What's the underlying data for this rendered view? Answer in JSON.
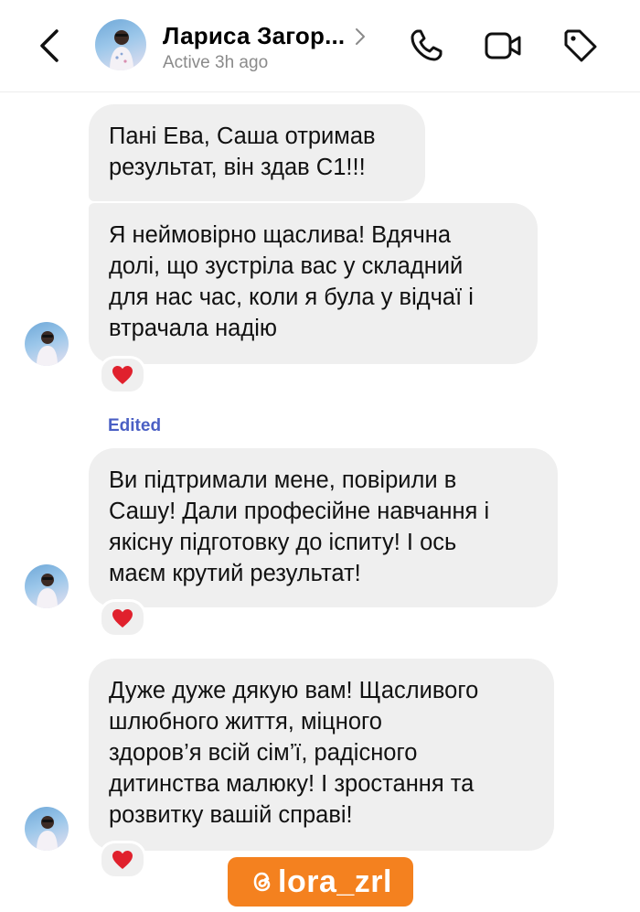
{
  "header": {
    "contact_name": "Лариса Загор...",
    "status": "Active 3h ago",
    "icons": [
      "back-arrow-icon",
      "chevron-right-icon",
      "phone-icon",
      "video-camera-icon",
      "tag-icon"
    ]
  },
  "messages": [
    {
      "text": "Пані Ева, Саша отримав\nрезультат, він здав С1!!!",
      "reaction": null
    },
    {
      "text": "Я неймовірно щаслива! Вдячна\nдолі, що зустріла вас у складний\nдля нас час, коли я була у відчаї і\nвтрачала надію",
      "reaction": "heart"
    },
    {
      "label": "Edited",
      "text": "Ви підтримали мене, повірили в\nСашу! Дали професійне навчання і\nякісну підготовку до іспиту! І ось\nмаєм крутий результат!",
      "reaction": "heart"
    },
    {
      "text": "Дуже дуже дякую вам! Щасливого\nшлюбного життя, міцного\nздоров’я всій сім’ї, радісного\nдитинства малюку! І зростання та\nрозвитку вашій справі!",
      "reaction": "heart"
    }
  ],
  "watermark": {
    "handle": "lora_zrl",
    "icon": "threads-icon"
  },
  "colors": {
    "bubble": "#efefef",
    "edited": "#4a5fc4",
    "heart": "#e0212d",
    "watermark_bg": "#f4811f"
  }
}
